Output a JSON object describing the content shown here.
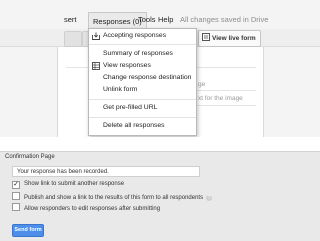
{
  "menubar": {
    "insert_partial": "sert",
    "responses": "Responses (0)",
    "tools": "Tools",
    "help": "Help",
    "saved": "All changes saved in Drive"
  },
  "toolbar": {
    "view_live_form": "View live form"
  },
  "editor_fragments": {
    "frag1": "ge",
    "frag2": "xt for the image"
  },
  "responses_menu": {
    "items": [
      {
        "label": "Accepting responses",
        "icon": "accepting-responses-icon"
      },
      {
        "label": "Summary of responses"
      },
      {
        "label": "View responses",
        "icon": "spreadsheet-icon"
      },
      {
        "label": "Change response destination"
      },
      {
        "label": "Unlink form"
      },
      {
        "label": "Get pre-filled URL"
      },
      {
        "label": "Delete all responses"
      }
    ]
  },
  "confirmation": {
    "section_label": "Confirmation Page",
    "message": "Your response has been recorded.",
    "options": [
      {
        "label": "Show link to submit another response",
        "checked": true
      },
      {
        "label": "Publish and show a link to the results of this form to all respondents",
        "checked": false,
        "help": "?"
      },
      {
        "label": "Allow responders to edit responses after submitting",
        "checked": false
      }
    ],
    "send_button": "Send form"
  },
  "colors": {
    "send_button": "#4d8fe8",
    "menu_bg": "#ffffff",
    "editor_bg": "#f4f4f4"
  }
}
